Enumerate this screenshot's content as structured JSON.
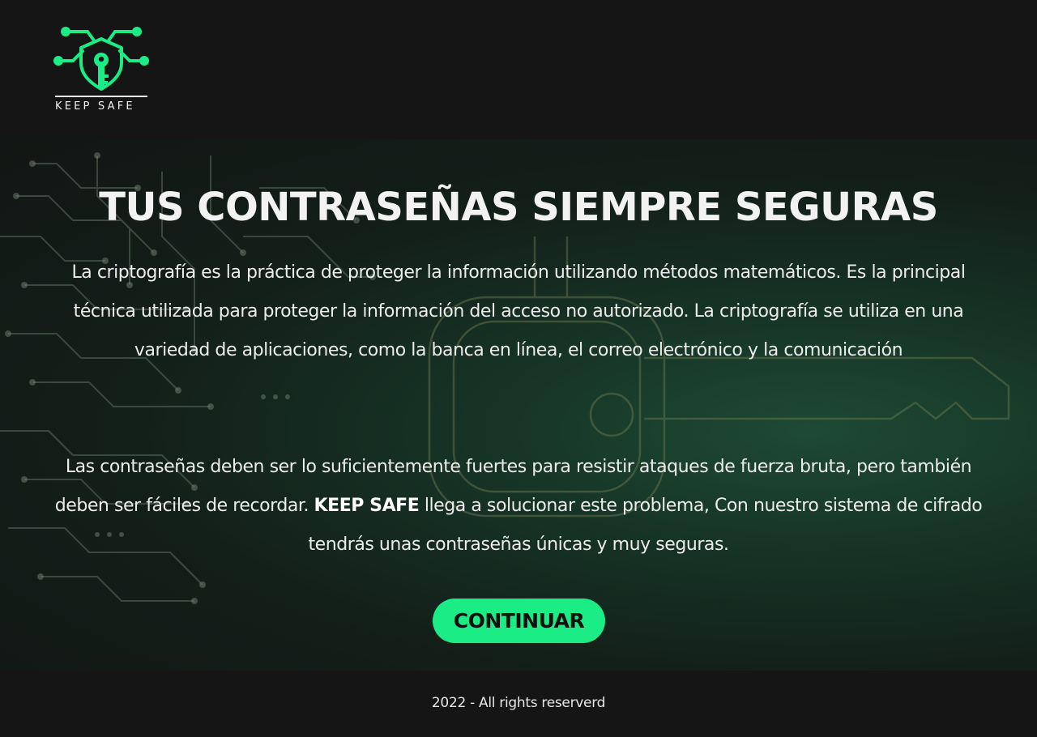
{
  "brand": {
    "logo_text": "KEEP SAFE",
    "accent_color": "#1bec85"
  },
  "hero": {
    "title": "TUS CONTRASEÑAS SIEMPRE SEGURAS",
    "paragraph1": "La criptografía es la práctica de proteger la información utilizando métodos matemáticos. Es la principal técnica utilizada para proteger la información del acceso no autorizado. La criptografía se utiliza en una variedad de aplicaciones, como la banca en línea, el correo electrónico y la comunicación",
    "paragraph2_before": "Las contraseñas deben ser lo suficientemente fuertes para resistir ataques de fuerza bruta, pero también deben ser fáciles de recordar. ",
    "paragraph2_brand": "KEEP SAFE",
    "paragraph2_after": " llega a solucionar este problema, Con nuestro sistema de cifrado tendrás unas contraseñas únicas y muy seguras.",
    "cta_label": "CONTINUAR",
    "background_icon": "circuit-key-icon"
  },
  "footer": {
    "copyright": "2022 - All rights reserverd"
  }
}
